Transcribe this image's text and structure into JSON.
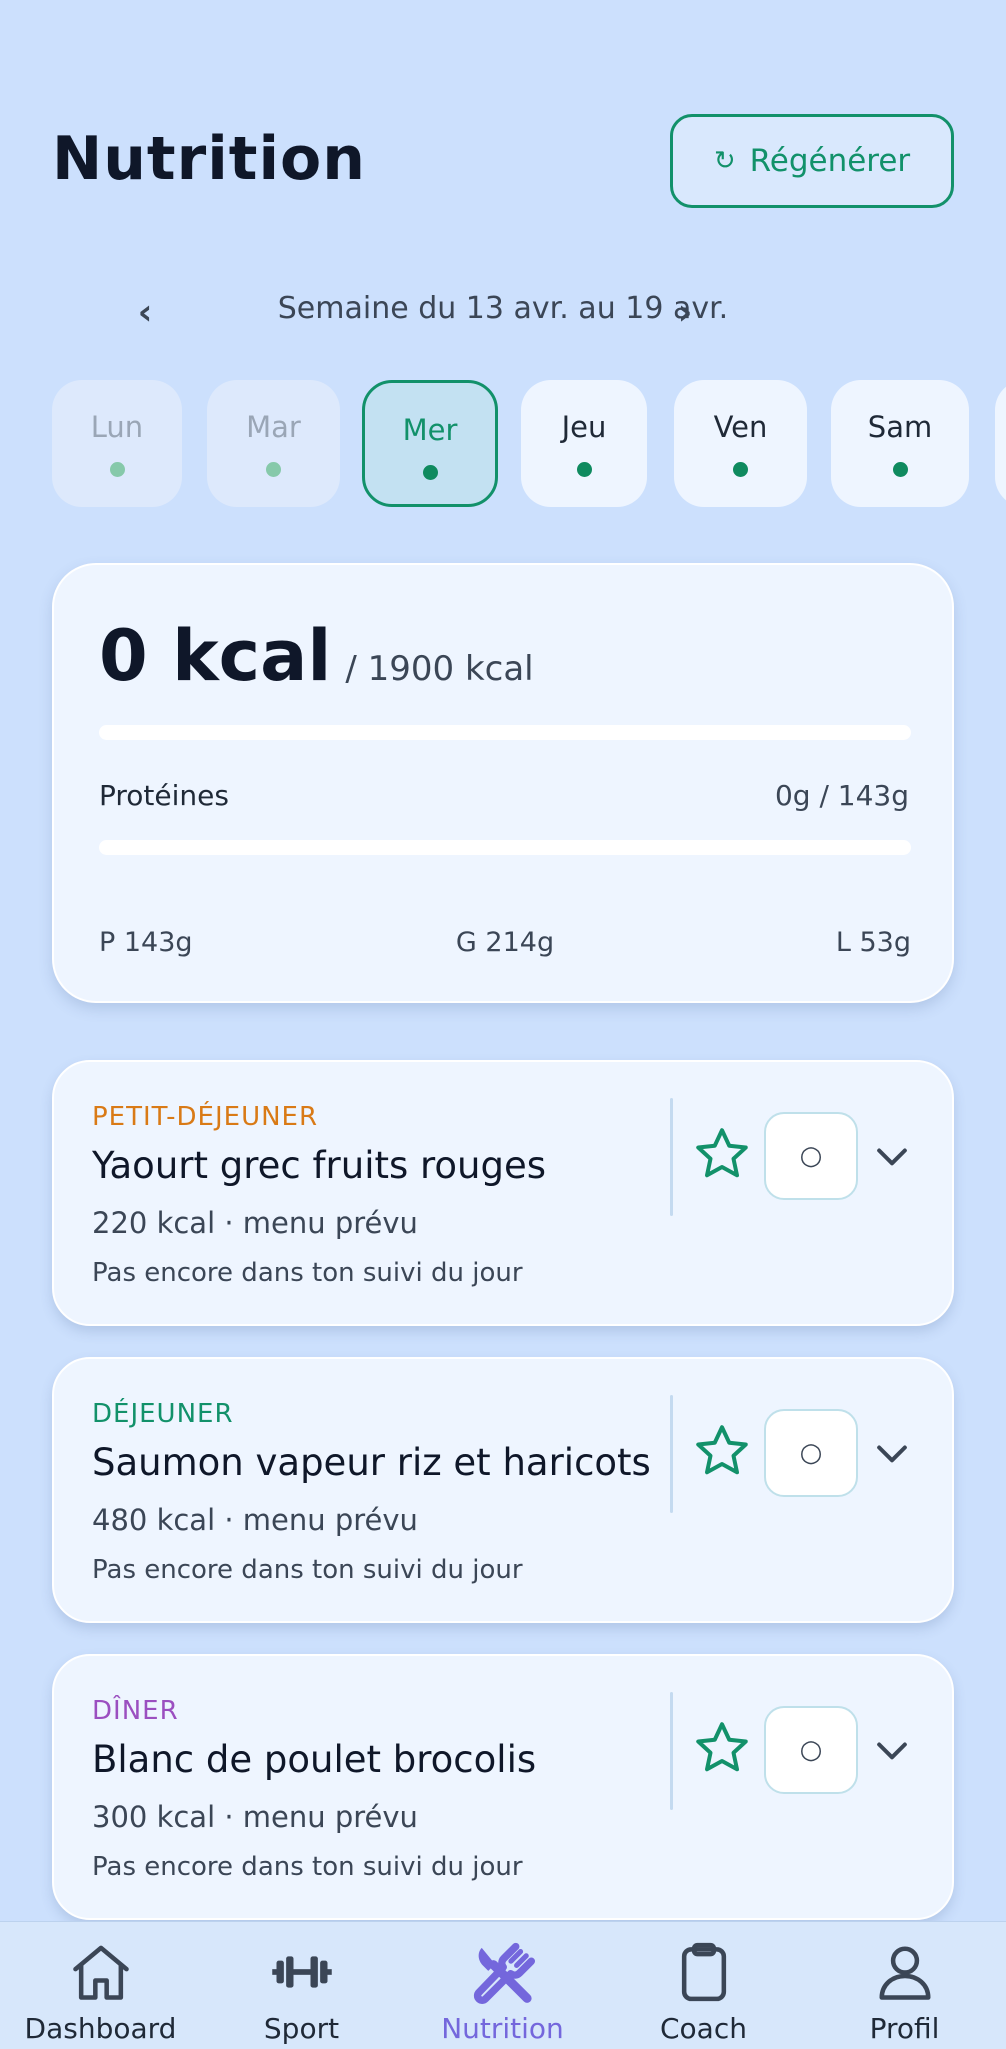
{
  "header": {
    "title": "Nutrition",
    "regenerate_label": "Régénérer",
    "regenerate_icon": "refresh-icon"
  },
  "week": {
    "prev_symbol": "‹",
    "next_symbol": "›",
    "label": "Semaine du 13 avr. au 19 avr."
  },
  "days": [
    {
      "label": "Lun",
      "state": "past"
    },
    {
      "label": "Mar",
      "state": "past"
    },
    {
      "label": "Mer",
      "state": "selected"
    },
    {
      "label": "Jeu",
      "state": "upcoming"
    },
    {
      "label": "Ven",
      "state": "upcoming"
    },
    {
      "label": "Sam",
      "state": "upcoming"
    }
  ],
  "summary": {
    "kcal_consumed": "0 kcal",
    "kcal_target": "/ 1900 kcal",
    "kcal_progress": 0,
    "protein_label": "Protéines",
    "protein_value": "0g / 143g",
    "protein_progress": 0,
    "macro_p": "P 143g",
    "macro_g": "G 214g",
    "macro_l": "L 53g"
  },
  "meals": [
    {
      "type": "PETIT-DÉJEUNER",
      "type_color": "#d97a16",
      "name": "Yaourt grec fruits rouges",
      "kcal": "220 kcal · menu prévu",
      "status": "Pas encore dans ton suivi du jour",
      "check_symbol": "○"
    },
    {
      "type": "DÉJEUNER",
      "type_color": "#12916a",
      "name": "Saumon vapeur riz et haricots",
      "kcal": "480 kcal · menu prévu",
      "status": "Pas encore dans ton suivi du jour",
      "check_symbol": "○"
    },
    {
      "type": "DÎNER",
      "type_color": "#9b4fc0",
      "name": "Blanc de poulet brocolis",
      "kcal": "300 kcal · menu prévu",
      "status": "Pas encore dans ton suivi du jour",
      "check_symbol": "○"
    }
  ],
  "nav": {
    "items": [
      {
        "label": "Dashboard",
        "icon": "home-icon"
      },
      {
        "label": "Sport",
        "icon": "dumbbell-icon"
      },
      {
        "label": "Nutrition",
        "icon": "utensils-icon",
        "active": true
      },
      {
        "label": "Coach",
        "icon": "clipboard-icon"
      },
      {
        "label": "Profil",
        "icon": "user-icon"
      }
    ],
    "active_color": "#7467dc"
  },
  "colors": {
    "accent": "#12916a",
    "background": "#cce0fd",
    "card": "#eef5ff"
  }
}
